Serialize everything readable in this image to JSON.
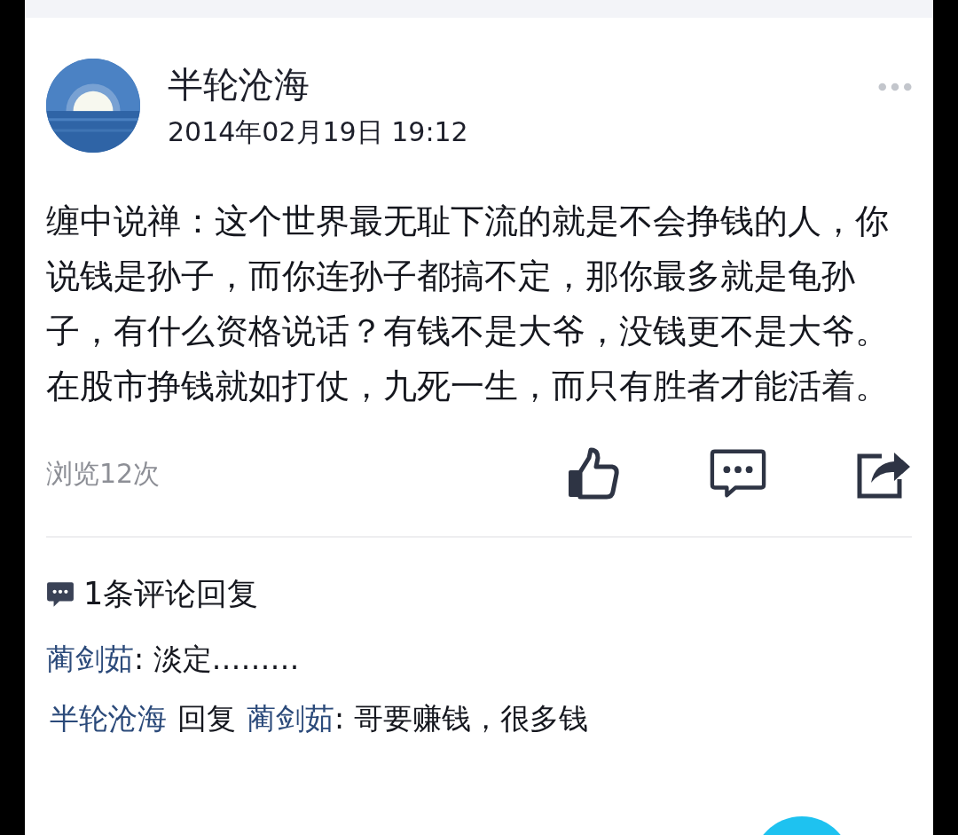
{
  "post": {
    "author": "半轮沧海",
    "time": "2014年02月19日 19:12",
    "body": "缠中说禅：这个世界最无耻下流的就是不会挣钱的人，你说钱是孙子，而你连孙子都搞不定，那你最多就是龟孙子，有什么资格说话？有钱不是大爷，没钱更不是大爷。在股市挣钱就如打仗，九死一生，而只有胜者才能活着。",
    "views": "浏览12次"
  },
  "comments": {
    "heading": "1条评论回复",
    "items": [
      {
        "author": "蔺剑茹",
        "text": ": 淡定………"
      },
      {
        "author": "半轮沧海",
        "reply_word": "回复",
        "reply_to": "蔺剑茹",
        "text": ": 哥要赚钱，很多钱"
      }
    ]
  }
}
